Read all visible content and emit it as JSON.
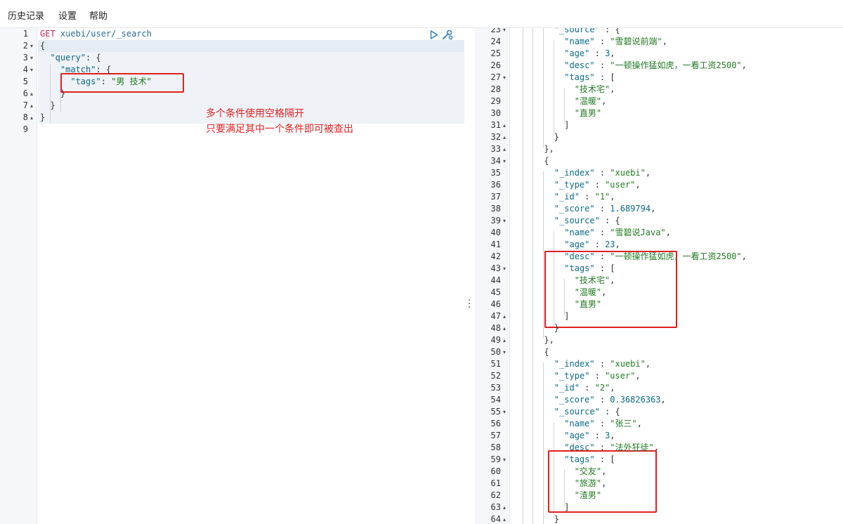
{
  "menu": {
    "history": "历史记录",
    "settings": "设置",
    "help": "帮助"
  },
  "request": {
    "lines": [
      {
        "num": "1",
        "fold": "",
        "text": "GET xuebi/user/_search"
      },
      {
        "num": "2",
        "fold": "▾",
        "text": "{"
      },
      {
        "num": "3",
        "fold": "▾",
        "text": "  \"query\": {"
      },
      {
        "num": "4",
        "fold": "▾",
        "text": "    \"match\": {"
      },
      {
        "num": "5",
        "fold": "",
        "text": "      \"tags\": \"男 技术\""
      },
      {
        "num": "6",
        "fold": "▴",
        "text": "    }"
      },
      {
        "num": "7",
        "fold": "▴",
        "text": "  }"
      },
      {
        "num": "8",
        "fold": "▴",
        "text": "}"
      },
      {
        "num": "9",
        "fold": "",
        "text": ""
      }
    ],
    "annotation_line1": "多个条件使用空格隔开",
    "annotation_line2": "只要满足其中一个条件即可被查出"
  },
  "response": {
    "lines": [
      {
        "num": "23",
        "fold": "▾",
        "text": "        \"_source\" : {"
      },
      {
        "num": "24",
        "fold": "",
        "text": "          \"name\" : \"雪碧说前端\","
      },
      {
        "num": "25",
        "fold": "",
        "text": "          \"age\" : 3,"
      },
      {
        "num": "26",
        "fold": "",
        "text": "          \"desc\" : \"一顿操作猛如虎，一看工资2500\","
      },
      {
        "num": "27",
        "fold": "▾",
        "text": "          \"tags\" : ["
      },
      {
        "num": "28",
        "fold": "",
        "text": "            \"技术宅\","
      },
      {
        "num": "29",
        "fold": "",
        "text": "            \"温暖\","
      },
      {
        "num": "30",
        "fold": "",
        "text": "            \"直男\""
      },
      {
        "num": "31",
        "fold": "▴",
        "text": "          ]"
      },
      {
        "num": "32",
        "fold": "▴",
        "text": "        }"
      },
      {
        "num": "33",
        "fold": "▴",
        "text": "      },"
      },
      {
        "num": "34",
        "fold": "▾",
        "text": "      {"
      },
      {
        "num": "35",
        "fold": "",
        "text": "        \"_index\" : \"xuebi\","
      },
      {
        "num": "36",
        "fold": "",
        "text": "        \"_type\" : \"user\","
      },
      {
        "num": "37",
        "fold": "",
        "text": "        \"_id\" : \"1\","
      },
      {
        "num": "38",
        "fold": "",
        "text": "        \"_score\" : 1.689794,"
      },
      {
        "num": "39",
        "fold": "▾",
        "text": "        \"_source\" : {"
      },
      {
        "num": "40",
        "fold": "",
        "text": "          \"name\" : \"雪碧说Java\","
      },
      {
        "num": "41",
        "fold": "",
        "text": "          \"age\" : 23,"
      },
      {
        "num": "42",
        "fold": "",
        "text": "          \"desc\" : \"一顿操作猛如虎，一看工资2500\","
      },
      {
        "num": "43",
        "fold": "▾",
        "text": "          \"tags\" : ["
      },
      {
        "num": "44",
        "fold": "",
        "text": "            \"技术宅\","
      },
      {
        "num": "45",
        "fold": "",
        "text": "            \"温暖\","
      },
      {
        "num": "46",
        "fold": "",
        "text": "            \"直男\""
      },
      {
        "num": "47",
        "fold": "▴",
        "text": "          ]"
      },
      {
        "num": "48",
        "fold": "▴",
        "text": "        }"
      },
      {
        "num": "49",
        "fold": "▴",
        "text": "      },"
      },
      {
        "num": "50",
        "fold": "▾",
        "text": "      {"
      },
      {
        "num": "51",
        "fold": "",
        "text": "        \"_index\" : \"xuebi\","
      },
      {
        "num": "52",
        "fold": "",
        "text": "        \"_type\" : \"user\","
      },
      {
        "num": "53",
        "fold": "",
        "text": "        \"_id\" : \"2\","
      },
      {
        "num": "54",
        "fold": "",
        "text": "        \"_score\" : 0.36826363,"
      },
      {
        "num": "55",
        "fold": "▾",
        "text": "        \"_source\" : {"
      },
      {
        "num": "56",
        "fold": "",
        "text": "          \"name\" : \"张三\","
      },
      {
        "num": "57",
        "fold": "",
        "text": "          \"age\" : 3,"
      },
      {
        "num": "58",
        "fold": "",
        "text": "          \"desc\" : \"法外狂徒\","
      },
      {
        "num": "59",
        "fold": "▾",
        "text": "          \"tags\" : ["
      },
      {
        "num": "60",
        "fold": "",
        "text": "            \"交友\","
      },
      {
        "num": "61",
        "fold": "",
        "text": "            \"旅游\","
      },
      {
        "num": "62",
        "fold": "",
        "text": "            \"渣男\""
      },
      {
        "num": "63",
        "fold": "▴",
        "text": "          ]"
      },
      {
        "num": "64",
        "fold": "▴",
        "text": "        }"
      }
    ]
  },
  "colors": {
    "highlight": "#e02020",
    "key": "#0b6a86",
    "string": "#227a22",
    "method": "#c0255a"
  },
  "icons": {
    "run": "play-icon",
    "settings": "wrench-icon",
    "resize": "vertical-dots-icon"
  }
}
